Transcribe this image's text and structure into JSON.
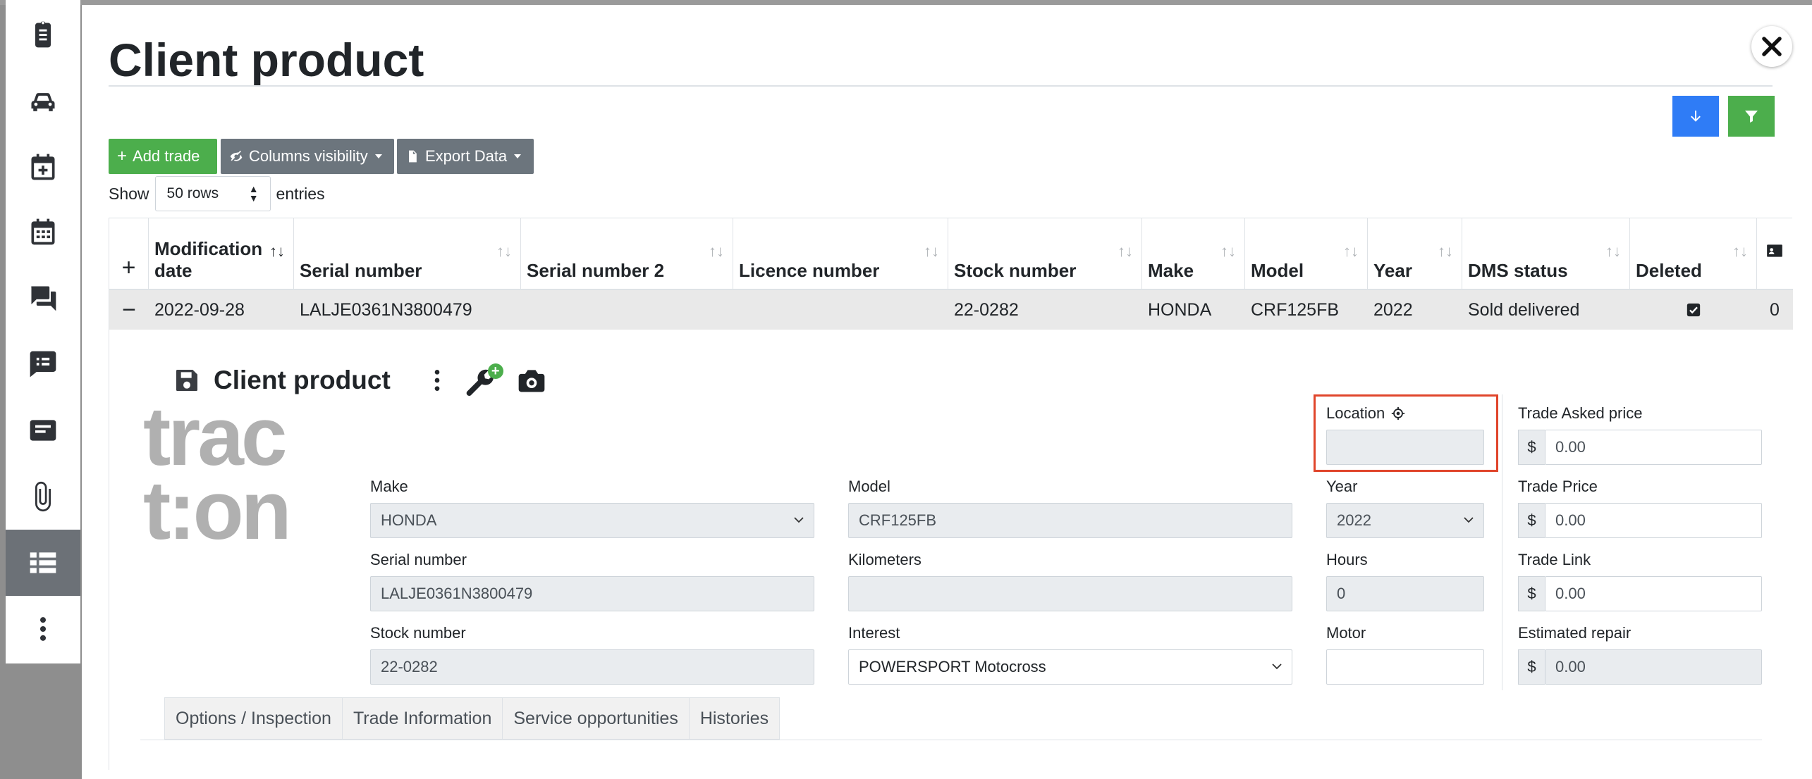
{
  "page": {
    "title": "Client product"
  },
  "toolbar": {
    "add_trade": "Add trade",
    "columns_visibility": "Columns visibility",
    "export_data": "Export Data"
  },
  "entries": {
    "show": "Show",
    "rows_value": "50 rows",
    "entries": "entries"
  },
  "table": {
    "headers": {
      "mod_date_line1": "Modification",
      "mod_date_line2": "date",
      "serial": "Serial number",
      "serial2": "Serial number 2",
      "licence": "Licence number",
      "stock": "Stock number",
      "make": "Make",
      "model": "Model",
      "year": "Year",
      "dms": "DMS status",
      "deleted": "Deleted"
    },
    "row": {
      "mod_date": "2022-09-28",
      "serial": "LALJE0361N3800479",
      "serial2": "",
      "licence": "",
      "stock": "22-0282",
      "make": "HONDA",
      "model": "CRF125FB",
      "year": "2022",
      "dms": "Sold delivered",
      "count": "0"
    }
  },
  "detail": {
    "title": "Client product",
    "logo_text_1": "trac",
    "logo_text_2": "t:on",
    "fields": {
      "location_label": "Location",
      "location_value": "",
      "make_label": "Make",
      "make_value": "HONDA",
      "model_label": "Model",
      "model_value": "CRF125FB",
      "year_label": "Year",
      "year_value": "2022",
      "serial_label": "Serial number",
      "serial_value": "LALJE0361N3800479",
      "kilometers_label": "Kilometers",
      "kilometers_value": "",
      "hours_label": "Hours",
      "hours_value": "0",
      "stock_label": "Stock number",
      "stock_value": "22-0282",
      "interest_label": "Interest",
      "interest_value": "POWERSPORT Motocross",
      "motor_label": "Motor",
      "motor_value": "",
      "currency": "$",
      "trade_asked_label": "Trade Asked price",
      "trade_asked_value": "0.00",
      "trade_price_label": "Trade Price",
      "trade_price_value": "0.00",
      "trade_link_label": "Trade Link",
      "trade_link_value": "0.00",
      "est_repair_label": "Estimated repair",
      "est_repair_value": "0.00"
    },
    "tabs": [
      "Options / Inspection",
      "Trade Information",
      "Service opportunities",
      "Histories"
    ]
  },
  "colors": {
    "accent_blue": "#2f7cf6",
    "accent_green": "#4cae4c",
    "highlight": "#e0452b"
  }
}
